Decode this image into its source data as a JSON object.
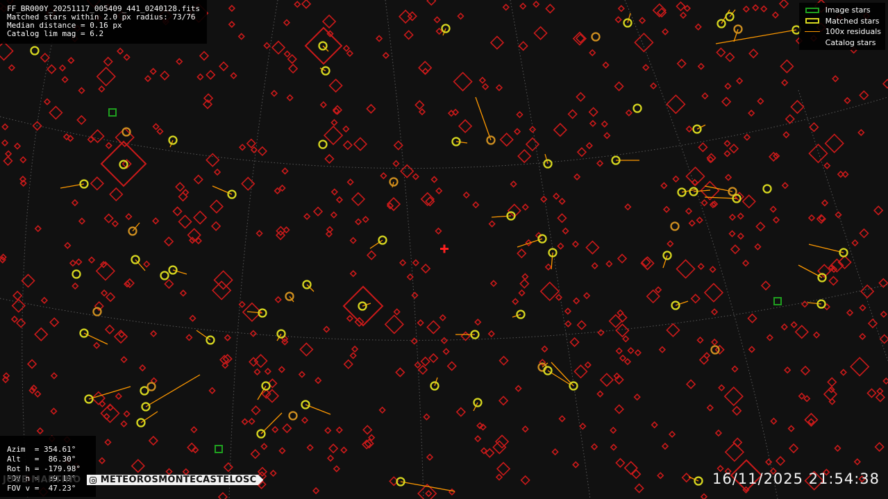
{
  "info": {
    "filename": "FF_BR000Y_20251117_005409_441_0240128.fits",
    "matched": "Matched stars within 2.0 px radius: 73/76",
    "median": "Median distance = 0.16 px",
    "limmag": "Catalog lim mag = 6.2"
  },
  "legend": {
    "image_stars": "Image stars",
    "matched_stars": "Matched stars",
    "residuals": "100x residuals",
    "catalog_stars": "Catalog stars"
  },
  "pointing": {
    "azim": "Azim  = 354.61°",
    "alt": "Alt   =  86.30°",
    "roth": "Rot h = -179.98°",
    "fovh": "FOV h =  89.19°",
    "fovv": "FOV v =  47.23°"
  },
  "banner": {
    "author": "JOSE MARTINO",
    "instagram": "METEOROSMONTECASTELOSC"
  },
  "timestamp": "16/11/2025 21:54:38",
  "colors": {
    "catalog": "#cc1a1a",
    "matched": "#d8d820",
    "matched_dim": "#d09020",
    "image": "#1fa01f",
    "residual": "#ff9900",
    "center": "#ff2020"
  }
}
